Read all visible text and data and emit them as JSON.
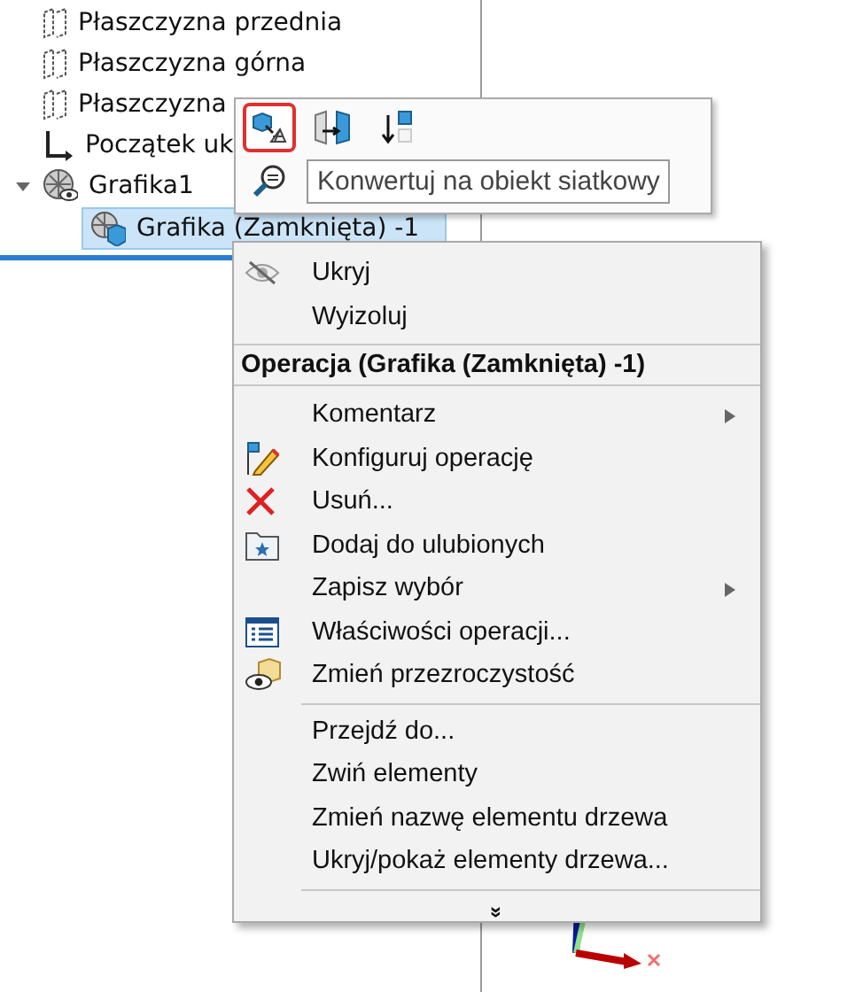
{
  "tree": {
    "items": [
      {
        "kind": "plane",
        "label": "Płaszczyzna przednia",
        "selected": false
      },
      {
        "kind": "plane",
        "label": "Płaszczyzna górna",
        "selected": false
      },
      {
        "kind": "plane",
        "label": "Płaszczyzna",
        "selected": false
      },
      {
        "kind": "origin",
        "label": "Początek uk",
        "selected": false
      },
      {
        "kind": "graphics",
        "label": "Grafika1",
        "selected": false,
        "expanded": true,
        "children": [
          {
            "kind": "graphics-body",
            "label": "Grafika (Zamknięta) -1",
            "selected": true
          }
        ]
      }
    ]
  },
  "toolbar": {
    "buttons": [
      {
        "kind": "convert",
        "highlighted": true
      },
      {
        "kind": "mirror",
        "highlighted": false
      },
      {
        "kind": "move-down",
        "highlighted": false
      }
    ],
    "zoom_button": {
      "kind": "zoom"
    },
    "tooltip": "Konwertuj na obiekt siatkowy"
  },
  "context_menu": {
    "items": [
      {
        "kind": "hide",
        "label": "Ukryj",
        "submenu": false
      },
      {
        "kind": "plain",
        "label": "Wyizoluj",
        "submenu": false
      },
      {
        "kind": "header",
        "label": "Operacja (Grafika (Zamknięta) -1)"
      },
      {
        "kind": "plain",
        "label": "Komentarz",
        "submenu": true
      },
      {
        "kind": "configure",
        "label": "Konfiguruj operację",
        "submenu": false
      },
      {
        "kind": "delete",
        "label": "Usuń...",
        "submenu": false
      },
      {
        "kind": "favorite",
        "label": "Dodaj do ulubionych",
        "submenu": false
      },
      {
        "kind": "plain",
        "label": "Zapisz wybór",
        "submenu": true
      },
      {
        "kind": "properties",
        "label": "Właściwości operacji...",
        "submenu": false
      },
      {
        "kind": "transparency",
        "label": "Zmień przezroczystość",
        "submenu": false
      },
      {
        "kind": "separator"
      },
      {
        "kind": "plain",
        "label": "Przejdź do...",
        "submenu": false
      },
      {
        "kind": "plain",
        "label": "Zwiń elementy",
        "submenu": false
      },
      {
        "kind": "plain",
        "label": "Zmień nazwę elementu drzewa",
        "submenu": false
      },
      {
        "kind": "plain",
        "label": "Ukryj/pokaż elementy drzewa...",
        "submenu": false
      },
      {
        "kind": "separator"
      },
      {
        "kind": "more",
        "label": "»"
      }
    ]
  }
}
